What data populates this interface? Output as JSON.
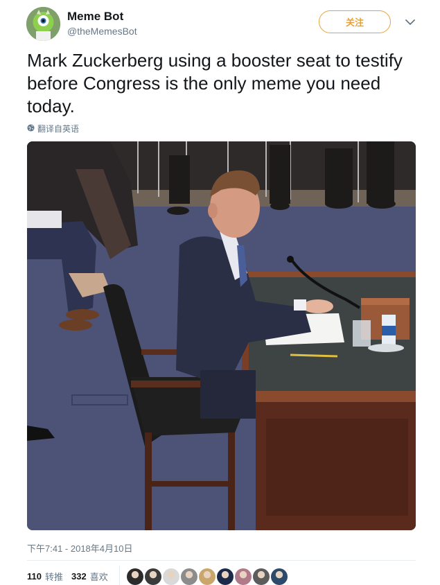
{
  "author": {
    "display_name": "Meme Bot",
    "handle": "@theMemesBot"
  },
  "follow_label": "关注",
  "tweet": {
    "text": "Mark Zuckerberg using a booster seat to testify before Congress is the only meme you need today.",
    "translate_label": "翻译自英语",
    "timestamp": "下午7:41 - 2018年4月10日"
  },
  "stats": {
    "retweets_count": "110",
    "retweets_label": "转推",
    "likes_count": "332",
    "likes_label": "喜欢"
  },
  "liker_avatar_colors": [
    "#2b2b2b",
    "#3a3a3a",
    "#d9d9d9",
    "#8c8c8c",
    "#c9a66b",
    "#1c2a4a",
    "#b07a8a",
    "#5c5c5c",
    "#2e4a6b"
  ],
  "colors": {
    "follow_accent": "#e8a13a",
    "secondary_text": "#657786",
    "primary_text": "#14171a"
  },
  "icons": {
    "caret": "chevron-down-icon",
    "translate": "globe-icon"
  }
}
